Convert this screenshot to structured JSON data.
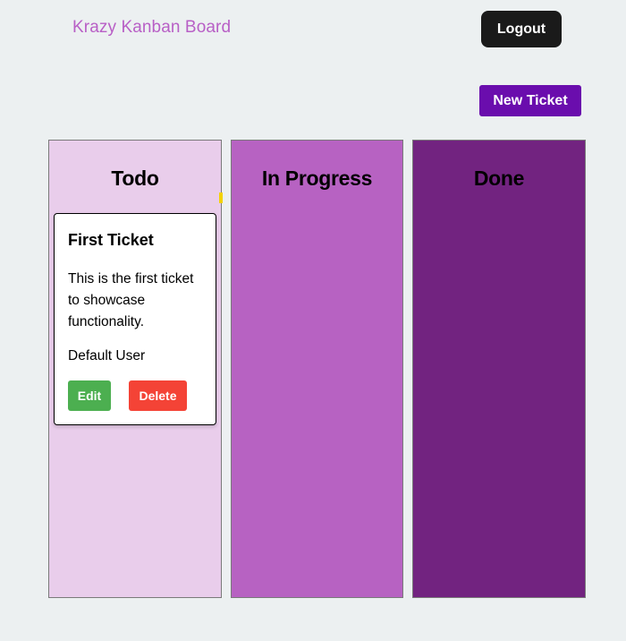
{
  "header": {
    "brand": "Krazy Kanban Board",
    "logout_label": "Logout"
  },
  "toolbar": {
    "new_ticket_label": "New Ticket"
  },
  "columns": [
    {
      "title": "Todo"
    },
    {
      "title": "In Progress"
    },
    {
      "title": "Done"
    }
  ],
  "tickets": [
    {
      "title": "First Ticket",
      "description": "This is the first ticket to showcase functionality.",
      "assignee": "Default User",
      "edit_label": "Edit",
      "delete_label": "Delete"
    }
  ],
  "colors": {
    "brand": "#b85fc6",
    "todo_bg": "#e9cdeb",
    "in_progress_bg": "#b762c2",
    "done_bg": "#722380",
    "new_ticket_bg": "#6a0dad",
    "edit_bg": "#4caf50",
    "delete_bg": "#f44336"
  }
}
